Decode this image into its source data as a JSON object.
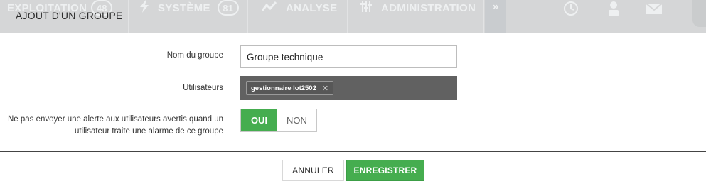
{
  "background_nav": {
    "items": [
      {
        "label": "EXPLOITATION",
        "badge": "48"
      },
      {
        "label": "SYSTÈME",
        "badge": "81"
      },
      {
        "label": "ANALYSE",
        "badge": ""
      },
      {
        "label": "ADMINISTRATION",
        "badge": ""
      }
    ],
    "more_glyph": "»"
  },
  "modal": {
    "title": "AJOUT D'UN GROUPE",
    "fields": {
      "name_label": "Nom du groupe",
      "name_value": "Groupe technique",
      "users_label": "Utilisateurs",
      "users": [
        "gestionnaire lot2502"
      ],
      "tag_remove_glyph": "✕",
      "alert_label_line1": "Ne pas envoyer une alerte aux utilisateurs avertis quand un",
      "alert_label_line2": "utilisateur traite une alarme de ce groupe",
      "toggle_on": "OUI",
      "toggle_off": "NON",
      "toggle_selected": "OUI"
    },
    "buttons": {
      "cancel": "ANNULER",
      "save": "ENREGISTRER"
    }
  },
  "colors": {
    "accent_green": "#45ad4f",
    "users_field_bg": "#616161",
    "header_bg": "#d5d6d7"
  }
}
